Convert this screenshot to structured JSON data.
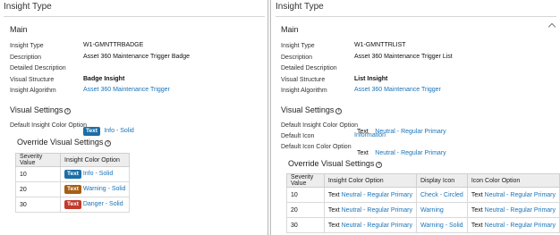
{
  "left": {
    "page_title": "Insight Type",
    "main_title": "Main",
    "fields": [
      {
        "label": "Insight Type",
        "value": "W1-GMNTTRBADGE"
      },
      {
        "label": "Description",
        "value": "Asset 360 Maintenance Trigger Badge"
      },
      {
        "label": "Detailed Description",
        "value": ""
      },
      {
        "label": "Visual Structure",
        "value": "Badge Insight"
      },
      {
        "label": "Insight Algorithm",
        "value": "Asset 360 Maintenance Trigger"
      }
    ],
    "visual_settings_title": "Visual Settings",
    "default_color_label": "Default Insight Color Option",
    "default_color_badge": "Text",
    "default_color_value": "Info - Solid",
    "override_title": "Override Visual Settings",
    "table_headers": [
      "Severity Value",
      "Insight Color Option"
    ],
    "rows": [
      {
        "severity": "10",
        "badge": "Text",
        "color": "Info - Solid"
      },
      {
        "severity": "20",
        "badge": "Text",
        "color": "Warning - Solid"
      },
      {
        "severity": "30",
        "badge": "Text",
        "color": "Danger - Solid"
      }
    ]
  },
  "right": {
    "page_title": "Insight Type",
    "main_title": "Main",
    "fields": [
      {
        "label": "Insight Type",
        "value": "W1-GMNTTRLIST"
      },
      {
        "label": "Description",
        "value": "Asset 360 Maintenance Trigger List"
      },
      {
        "label": "Detailed Description",
        "value": ""
      },
      {
        "label": "Visual Structure",
        "value": "List Insight"
      },
      {
        "label": "Insight Algorithm",
        "value": "Asset 360 Maintenance Trigger"
      }
    ],
    "visual_settings_title": "Visual Settings",
    "default_color_label": "Default Insight Color Option",
    "default_color_text": "Text",
    "default_color_value": "Neutral - Regular Primary",
    "default_icon_label": "Default Icon",
    "default_icon_value": "Information",
    "default_icon_color_label": "Default Icon Color Option",
    "default_icon_color_text": "Text",
    "default_icon_color_value": "Neutral - Regular Primary",
    "override_title": "Override Visual Settings",
    "table_headers": [
      "Severity Value",
      "Insight Color Option",
      "Display Icon",
      "Icon Color Option"
    ],
    "rows": [
      {
        "severity": "10",
        "text1": "Text",
        "color": "Neutral - Regular Primary",
        "icon": "Check - Circled",
        "text2": "Text",
        "icon_color": "Neutral - Regular Primary"
      },
      {
        "severity": "20",
        "text1": "Text",
        "color": "Neutral - Regular Primary",
        "icon": "Warning",
        "text2": "Text",
        "icon_color": "Neutral - Regular Primary"
      },
      {
        "severity": "30",
        "text1": "Text",
        "color": "Neutral - Regular Primary",
        "icon": "Warning - Solid",
        "text2": "Text",
        "icon_color": "Neutral - Regular Primary"
      }
    ]
  },
  "colors": {
    "link": "#1a73b8",
    "info_badge": "#1b6fa8",
    "warning_badge": "#a65e12",
    "danger_badge": "#c23a2b"
  }
}
